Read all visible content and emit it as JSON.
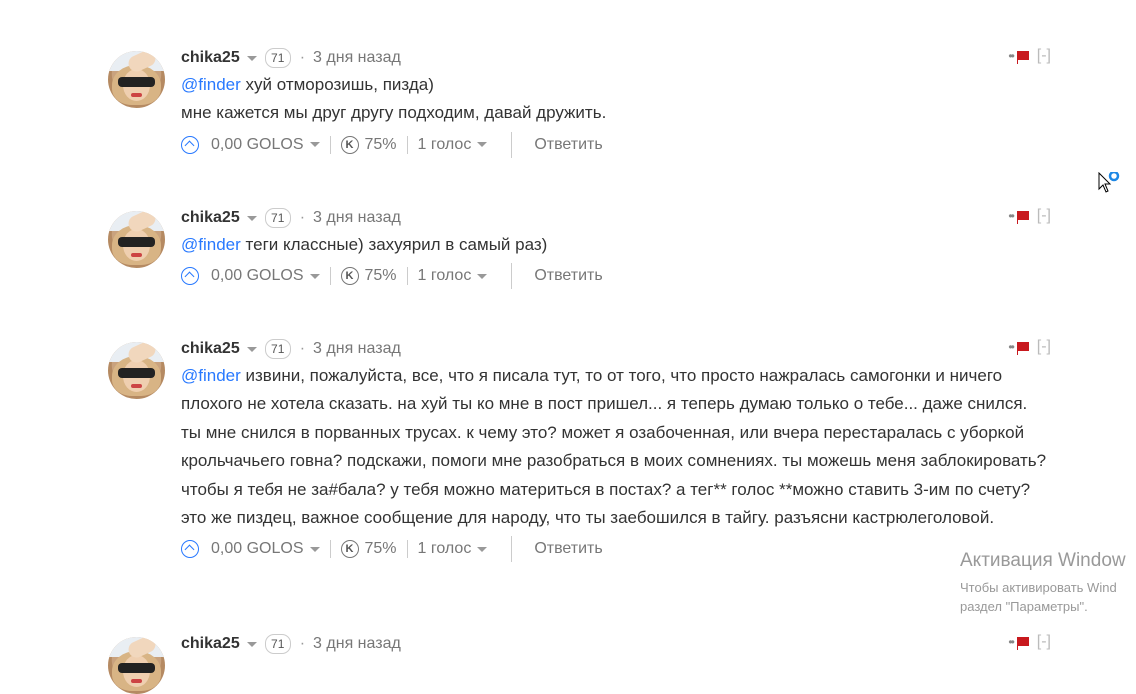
{
  "comments": [
    {
      "author": "chika25",
      "reputation": "71",
      "time": "3 дня назад",
      "mention": "@finder",
      "text": " хуй отморозишь, пизда)",
      "extra_line": "мне кажется мы друг другу подходим, давай дружить.",
      "payout": "0,00 GOLOS",
      "curation_icon": "K",
      "curation": "75%",
      "votes": "1 голос",
      "reply": "Ответить",
      "collapse": "[-]"
    },
    {
      "author": "chika25",
      "reputation": "71",
      "time": "3 дня назад",
      "mention": "@finder",
      "text": " теги классные) захуярил в самый раз)",
      "payout": "0,00 GOLOS",
      "curation_icon": "K",
      "curation": "75%",
      "votes": "1 голос",
      "reply": "Ответить",
      "collapse": "[-]"
    },
    {
      "author": "chika25",
      "reputation": "71",
      "time": "3 дня назад",
      "mention": "@finder",
      "text": " извини, пожалуйста, все, что я писала тут, то от того, что просто нажралась самогонки и ничего плохого не хотела сказать. на хуй ты ко мне в пост пришел... я теперь думаю только о тебе... даже снился. ты мне снился в порванных трусах. к чему это? может я озабоченная, или вчера перестаралась с уборкой крольчачьего говна? подскажи, помоги мне разобраться в моих сомнениях. ты можешь меня заблокировать? чтобы я тебя не за#бала? у тебя можно материться в постах? а тег** голос **можно ставить 3-им по счету? это же пиздец, важное сообщение для народу, что ты заебошился в тайгу. разъясни кастрюлеголовой.",
      "payout": "0,00 GOLOS",
      "curation_icon": "K",
      "curation": "75%",
      "votes": "1 голос",
      "reply": "Ответить",
      "collapse": "[-]"
    },
    {
      "author": "chika25",
      "reputation": "71",
      "time": "3 дня назад",
      "collapse": "[-]"
    }
  ],
  "activation": {
    "title": "Активация Window",
    "line1": "Чтобы активировать Wind",
    "line2": "раздел \"Параметры\"."
  },
  "colors": {
    "accent": "#2879ff",
    "flag": "#c8191e"
  }
}
